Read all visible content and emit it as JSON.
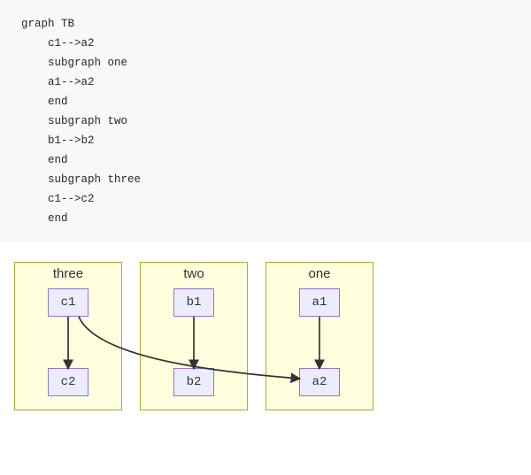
{
  "code": {
    "lines": [
      "graph TB",
      "    c1-->a2",
      "    subgraph one",
      "    a1-->a2",
      "    end",
      "    subgraph two",
      "    b1-->b2",
      "    end",
      "    subgraph three",
      "    c1-->c2",
      "    end"
    ]
  },
  "diagram": {
    "subgraphs": {
      "three": {
        "title": "three",
        "top_node": "c1",
        "bottom_node": "c2"
      },
      "two": {
        "title": "two",
        "top_node": "b1",
        "bottom_node": "b2"
      },
      "one": {
        "title": "one",
        "top_node": "a1",
        "bottom_node": "a2"
      }
    },
    "edges": [
      {
        "from": "c1",
        "to": "c2"
      },
      {
        "from": "b1",
        "to": "b2"
      },
      {
        "from": "a1",
        "to": "a2"
      },
      {
        "from": "c1",
        "to": "a2"
      }
    ]
  },
  "colors": {
    "code_bg": "#f6f8fa",
    "subgraph_bg": "#ffffde",
    "subgraph_border": "#aaaa33",
    "node_bg": "#ececff",
    "node_border": "#9370DB",
    "edge": "#333333"
  }
}
